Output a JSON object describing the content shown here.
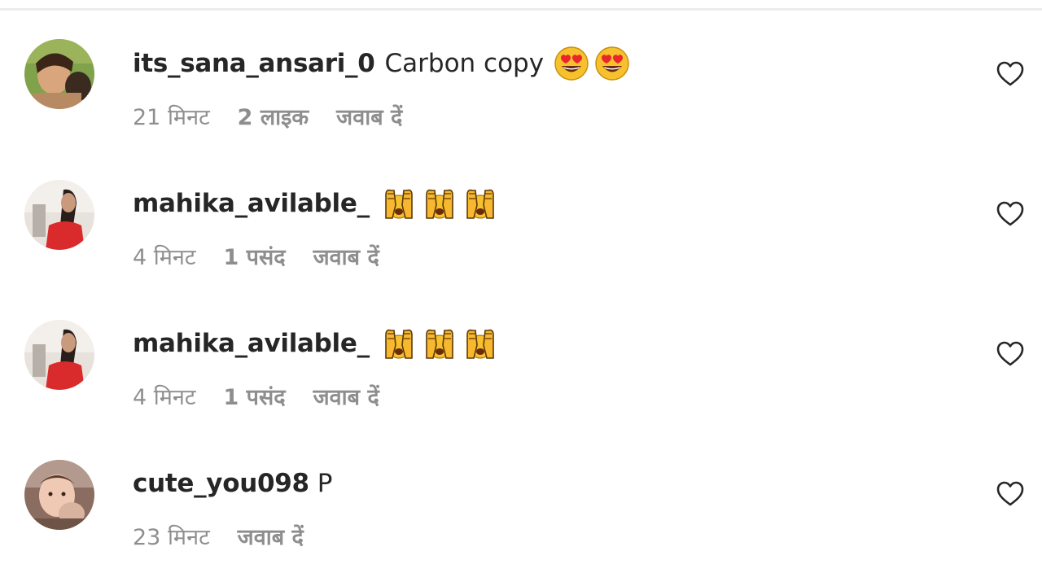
{
  "comments": [
    {
      "username": "its_sana_ansari_0",
      "text": "Carbon copy",
      "emoji": "smiling-face-with-heart-eyes",
      "emoji_count": 2,
      "time": "21 मिनट",
      "likes": "2 लाइक",
      "reply": "जवाब दें"
    },
    {
      "username": "mahika_avilable_",
      "text": "",
      "emoji": "raising-hands",
      "emoji_count": 3,
      "time": "4 मिनट",
      "likes": "1 पसंद",
      "reply": "जवाब दें"
    },
    {
      "username": "mahika_avilable_",
      "text": "",
      "emoji": "raising-hands",
      "emoji_count": 3,
      "time": "4 मिनट",
      "likes": "1 पसंद",
      "reply": "जवाब दें"
    },
    {
      "username": "cute_you098",
      "text": "P",
      "emoji": "",
      "emoji_count": 0,
      "time": "23 मिनट",
      "likes": "",
      "reply": "जवाब दें"
    }
  ],
  "icons": {
    "like": "heart-outline-icon"
  },
  "colors": {
    "text": "#262626",
    "secondary": "#8e8e8e",
    "divider": "#ececec"
  }
}
